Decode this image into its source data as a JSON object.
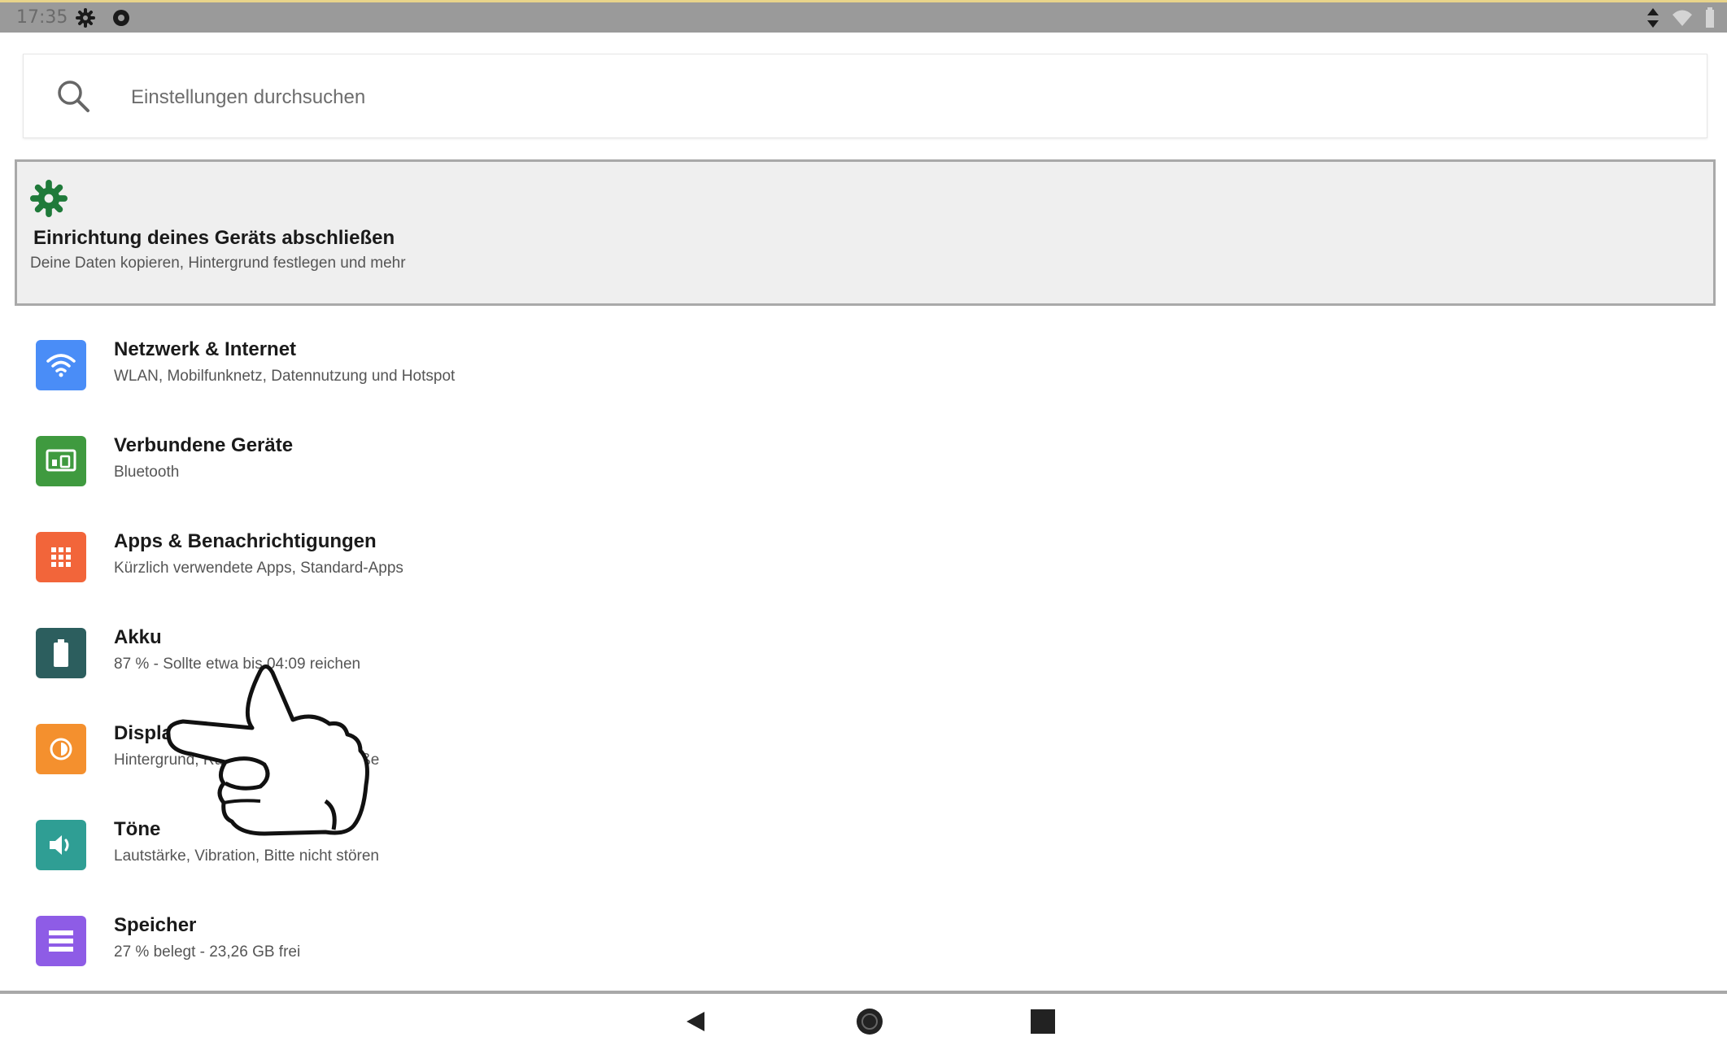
{
  "status_bar": {
    "time": "17:35",
    "left_icons": [
      "gear-icon",
      "notification-icon"
    ],
    "right_icons": [
      "data-transfer-icon",
      "wifi-icon",
      "battery-icon"
    ]
  },
  "search": {
    "placeholder": "Einstellungen durchsuchen"
  },
  "setup_card": {
    "icon": "gear-icon",
    "title": "Einrichtung deines Geräts abschließen",
    "subtitle": "Deine Daten kopieren, Hintergrund festlegen und mehr"
  },
  "settings": [
    {
      "icon": "wifi-icon",
      "color": "#4a8df7",
      "title": "Netzwerk & Internet",
      "subtitle": "WLAN, Mobilfunknetz, Datennutzung und Hotspot"
    },
    {
      "icon": "connected-devices-icon",
      "color": "#3f9a3f",
      "title": "Verbundene Geräte",
      "subtitle": "Bluetooth"
    },
    {
      "icon": "apps-grid-icon",
      "color": "#f2653a",
      "title": "Apps & Benachrichtigungen",
      "subtitle": "Kürzlich verwendete Apps, Standard-Apps"
    },
    {
      "icon": "battery-icon",
      "color": "#2c5e5e",
      "title": "Akku",
      "subtitle": "87 % - Sollte etwa bis 04:09 reichen"
    },
    {
      "icon": "brightness-icon",
      "color": "#f4902e",
      "title": "Display",
      "subtitle": "Hintergrund, Ruhemodus, Schriftgröße"
    },
    {
      "icon": "volume-icon",
      "color": "#2f9e94",
      "title": "Töne",
      "subtitle": "Lautstärke, Vibration, Bitte nicht stören"
    },
    {
      "icon": "storage-icon",
      "color": "#8e5ce6",
      "title": "Speicher",
      "subtitle": "27 % belegt - 23,26 GB frei"
    }
  ],
  "nav_bar": {
    "buttons": [
      "back-icon",
      "home-icon",
      "recents-icon"
    ]
  },
  "overlay": {
    "pointer": "pointing-hand-icon"
  }
}
